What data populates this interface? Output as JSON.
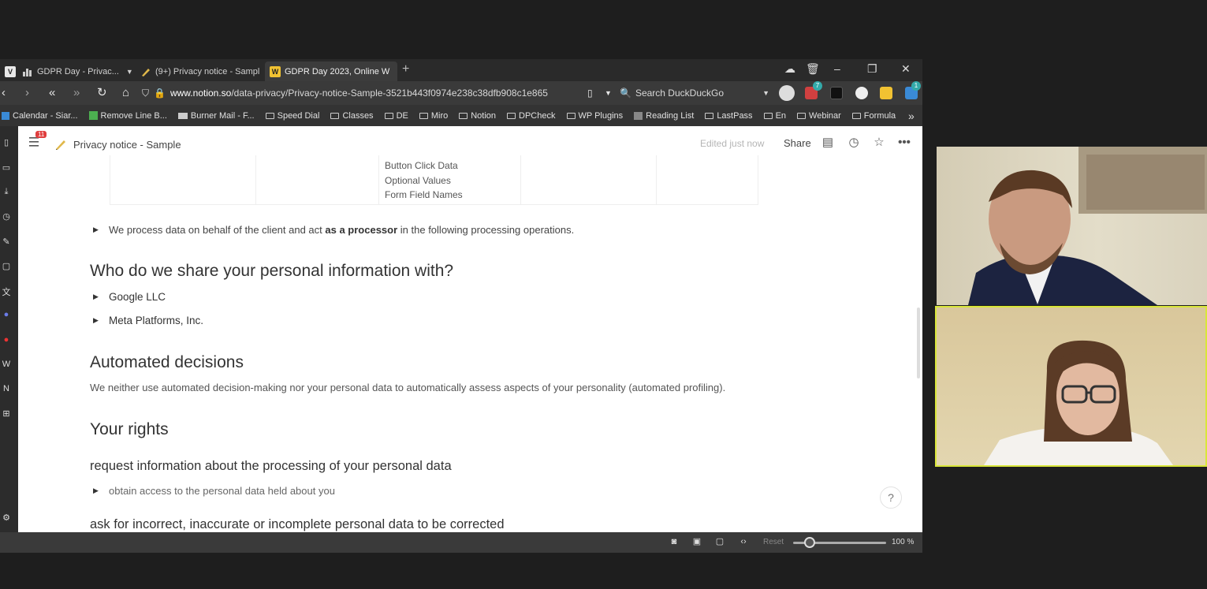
{
  "browser": {
    "tabs": [
      {
        "label": "GDPR Day - Privac...",
        "favicon": "chart-icon"
      },
      {
        "label": "(9+) Privacy notice - Sampl",
        "favicon": "notion-pen-icon",
        "badge": "9"
      },
      {
        "label": "GDPR Day 2023, Online W",
        "favicon": "w-logo-icon"
      }
    ],
    "active_tab_index": 2,
    "url_host": "www.notion.so",
    "url_path": "/data-privacy/Privacy-notice-Sample-3521b443f0974e238c38dfb908c1e865",
    "search_placeholder": "Search DuckDuckGo",
    "extension_badges": {
      "mail": "7",
      "bell": "1"
    },
    "bookmarks": [
      {
        "label": "Calendar - Siar...",
        "icon": "calendar-icon"
      },
      {
        "label": "Remove Line B...",
        "icon": "tool-icon"
      },
      {
        "label": "Burner Mail - F...",
        "icon": "mail-icon"
      },
      {
        "label": "Speed Dial",
        "icon": "speed-dial-icon"
      },
      {
        "label": "Classes",
        "icon": "folder-icon"
      },
      {
        "label": "DE",
        "icon": "folder-icon"
      },
      {
        "label": "Miro",
        "icon": "folder-icon"
      },
      {
        "label": "Notion",
        "icon": "folder-icon"
      },
      {
        "label": "DPCheck",
        "icon": "folder-icon"
      },
      {
        "label": "WP Plugins",
        "icon": "folder-icon"
      },
      {
        "label": "Reading List",
        "icon": "reading-list-icon"
      },
      {
        "label": "LastPass",
        "icon": "folder-icon"
      },
      {
        "label": "En",
        "icon": "folder-icon"
      },
      {
        "label": "Webinar",
        "icon": "folder-icon"
      },
      {
        "label": "Formula",
        "icon": "folder-icon"
      }
    ],
    "more_bookmarks": "»",
    "status": {
      "reset_label": "Reset",
      "zoom": "100 %"
    }
  },
  "notion": {
    "breadcrumb": "Privacy notice - Sample",
    "notification_count": "11",
    "edited": "Edited just now",
    "share_label": "Share",
    "table_cells": [
      "Button Click Data",
      "Optional Values",
      "Form Field Names"
    ],
    "processor_line": {
      "before": "We process data on behalf of the client and act ",
      "bold": "as a processor",
      "after": " in the following processing operations."
    },
    "sections": {
      "share_heading": "Who do we share your personal information with?",
      "share_items": [
        "Google LLC",
        "Meta Platforms, Inc."
      ],
      "automated_heading": "Automated decisions",
      "automated_text": "We neither use automated decision-making nor your personal data to automatically assess aspects of your personality (automated profiling).",
      "rights_heading": "Your rights",
      "rights_sub1": "request information about the processing of your personal data",
      "rights_sub1_item": "obtain access to the personal data held about you",
      "rights_sub2": "ask for incorrect, inaccurate or incomplete personal data to be corrected"
    },
    "help_label": "?"
  }
}
